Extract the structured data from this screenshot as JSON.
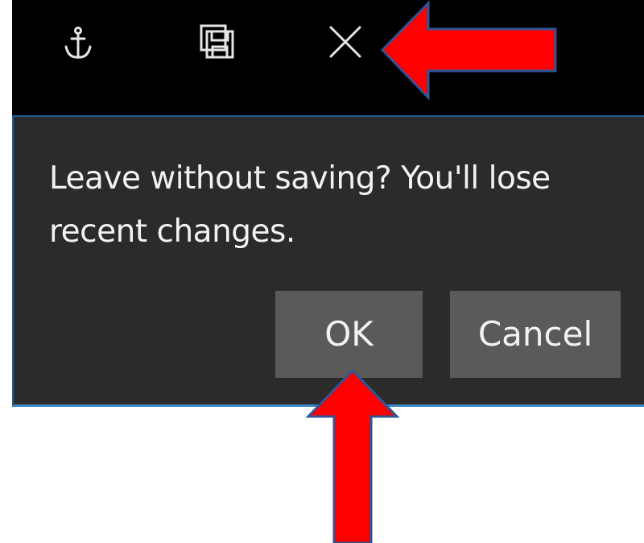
{
  "titlebar": {
    "icons": [
      "anchor-icon",
      "save-icon",
      "close-icon"
    ]
  },
  "dialog": {
    "message": "Leave without saving? You'll lose recent changes.",
    "ok_label": "OK",
    "cancel_label": "Cancel"
  },
  "colors": {
    "titlebar_bg": "#000000",
    "dialog_bg": "#2b2b2b",
    "button_bg": "#5a5a5a",
    "text": "#f2f2f2",
    "dialog_border": "#3a86c9",
    "annotation_arrow": "#ff0000",
    "annotation_arrow_outline": "#2f5597"
  },
  "annotations": [
    {
      "name": "arrow-to-close-button",
      "direction": "left"
    },
    {
      "name": "arrow-to-ok-button",
      "direction": "up"
    }
  ]
}
